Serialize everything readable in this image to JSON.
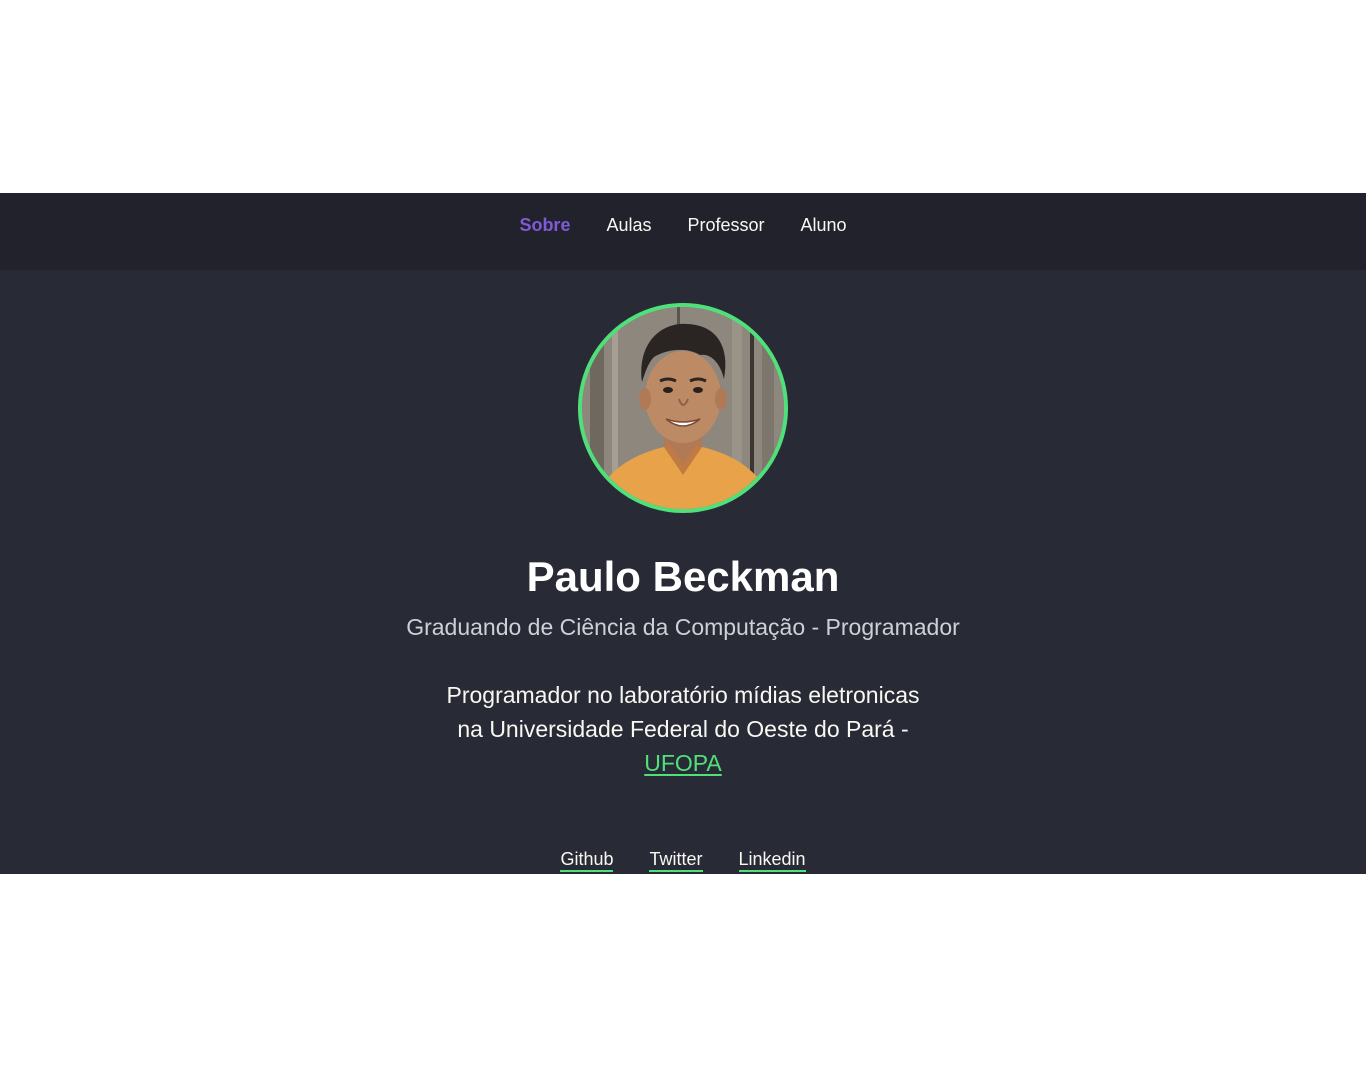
{
  "nav": {
    "items": [
      {
        "label": "Sobre",
        "active": true
      },
      {
        "label": "Aulas",
        "active": false
      },
      {
        "label": "Professor",
        "active": false
      },
      {
        "label": "Aluno",
        "active": false
      }
    ]
  },
  "profile": {
    "name": "Paulo Beckman",
    "subtitle": "Graduando de Ciência da Computação - Programador",
    "bio_line1": "Programador no laboratório mídias eletronicas",
    "bio_line2": "na Universidade Federal do Oeste do Pará -",
    "bio_link": "UFOPA"
  },
  "socials": [
    {
      "label": "Github"
    },
    {
      "label": "Twitter"
    },
    {
      "label": "Linkedin"
    }
  ],
  "colors": {
    "background": "#282a36",
    "navbar": "#21222c",
    "accent_green": "#50e07a",
    "accent_purple": "#7e5bd6",
    "text": "#f8f8f2"
  }
}
